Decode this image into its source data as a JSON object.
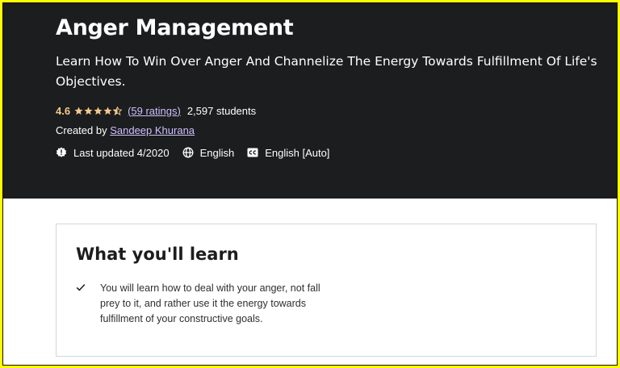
{
  "course": {
    "title": "Anger Management",
    "subtitle": "Learn How To Win Over Anger And Channelize The Energy Towards Fulfillment Of Life's Objectives.",
    "rating": "4.6",
    "rating_stars_value": 4.6,
    "rating_stars_max": 5,
    "ratings_count": "(59 ratings)",
    "students": "2,597 students",
    "created_by_label": "Created by",
    "creator": "Sandeep Khurana",
    "last_updated": "Last updated 4/2020",
    "language": "English",
    "captions": "English [Auto]"
  },
  "learn": {
    "heading": "What you'll learn",
    "items": [
      "You will learn how to deal with your anger, not fall prey to it, and rather use it the energy towards fulfillment of your constructive goals."
    ]
  },
  "icons": {
    "star": "star-icon",
    "half_star": "star-half-icon",
    "update": "alert-badge-icon",
    "language": "globe-icon",
    "captions": "closed-captions-icon",
    "check": "check-icon"
  },
  "colors": {
    "hero_bg": "#1c1d1f",
    "rating": "#f3ca8c",
    "link": "#cec0fc",
    "frame": "#ffff00"
  }
}
